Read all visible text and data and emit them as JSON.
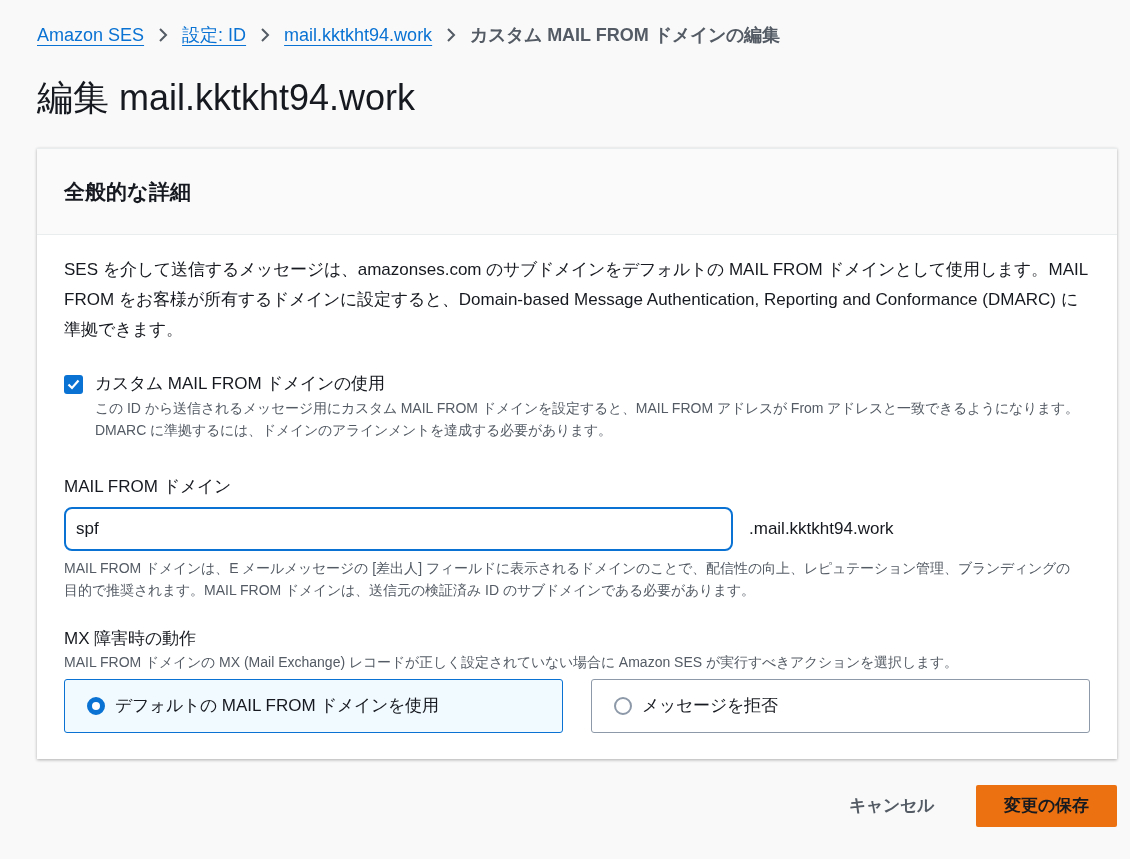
{
  "breadcrumbs": [
    {
      "label": "Amazon SES",
      "link": true
    },
    {
      "label": "設定: ID",
      "link": true
    },
    {
      "label": "mail.kktkht94.work",
      "link": true
    },
    {
      "label": "カスタム MAIL FROM ドメインの編集",
      "link": false
    }
  ],
  "title": "編集 mail.kktkht94.work",
  "card": {
    "header": "全般的な詳細",
    "description": "SES を介して送信するメッセージは、amazonses.com のサブドメインをデフォルトの MAIL FROM ドメインとして使用します。MAIL FROM をお客様が所有するドメインに設定すると、Domain-based Message Authentication, Reporting and Conformance (DMARC) に準拠できます。",
    "checkbox": {
      "label": "カスタム MAIL FROM ドメインの使用",
      "description": "この ID から送信されるメッセージ用にカスタム MAIL FROM ドメインを設定すると、MAIL FROM アドレスが From アドレスと一致できるようになります。DMARC に準拠するには、ドメインのアラインメントを達成する必要があります。",
      "checked": true
    },
    "mail_from": {
      "label": "MAIL FROM ドメイン",
      "value": "spf",
      "suffix": ".mail.kktkht94.work",
      "hint": "MAIL FROM ドメインは、E メールメッセージの [差出人] フィールドに表示されるドメインのことで、配信性の向上、レピュテーション管理、ブランディングの目的で推奨されます。MAIL FROM ドメインは、送信元の検証済み ID のサブドメインである必要があります。"
    },
    "mx": {
      "label": "MX 障害時の動作",
      "description": "MAIL FROM ドメインの MX (Mail Exchange) レコードが正しく設定されていない場合に Amazon SES が実行すべきアクションを選択します。",
      "options": [
        {
          "label": "デフォルトの MAIL FROM ドメインを使用",
          "selected": true
        },
        {
          "label": "メッセージを拒否",
          "selected": false
        }
      ]
    }
  },
  "buttons": [
    {
      "label": "キャンセル",
      "kind": "secondary"
    },
    {
      "label": "変更の保存",
      "kind": "primary"
    }
  ]
}
